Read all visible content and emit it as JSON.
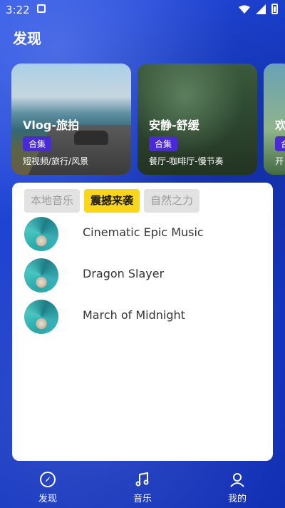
{
  "status_bar": {
    "time": "3:22"
  },
  "page_title": "发现",
  "cards": [
    {
      "title": "Vlog-旅拍",
      "badge": "合集",
      "subtitle": "短视频/旅行/风景"
    },
    {
      "title": "安静-舒缓",
      "badge": "合集",
      "subtitle": "餐厅-咖啡厅-慢节奏"
    },
    {
      "title": "欢",
      "badge": "合",
      "subtitle": "开"
    }
  ],
  "tabs": [
    {
      "label": "本地音乐",
      "active": false
    },
    {
      "label": "震撼来袭",
      "active": true
    },
    {
      "label": "自然之力",
      "active": false
    }
  ],
  "songs": [
    {
      "title": "Cinematic Epic Music"
    },
    {
      "title": "Dragon Slayer"
    },
    {
      "title": "March of Midnight"
    }
  ],
  "bottom_nav": [
    {
      "label": "发现",
      "icon": "compass-icon"
    },
    {
      "label": "音乐",
      "icon": "music-note-icon"
    },
    {
      "label": "我的",
      "icon": "profile-icon"
    }
  ],
  "colors": {
    "background": "#1b3fd3",
    "accent_tab": "#fad61b",
    "badge": "#4a2ad8"
  }
}
